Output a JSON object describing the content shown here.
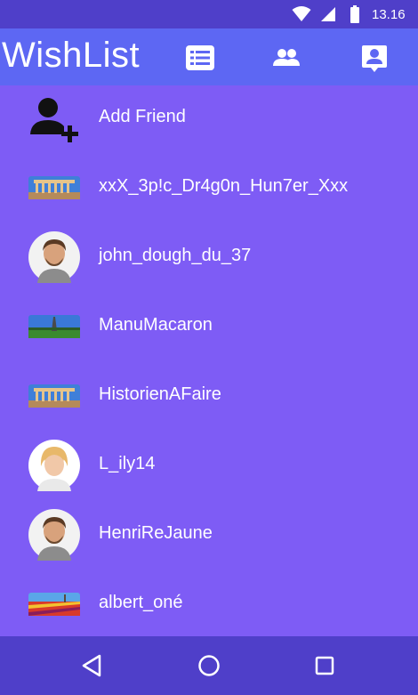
{
  "status_bar": {
    "time": "13.16",
    "icons": [
      "wifi-icon",
      "signal-icon",
      "battery-icon"
    ]
  },
  "app_bar": {
    "title": "WishList",
    "tabs": [
      {
        "icon": "list-icon"
      },
      {
        "icon": "people-icon"
      },
      {
        "icon": "account-box-icon"
      }
    ],
    "color": "#5d67f3"
  },
  "friends": {
    "add_friend_label": "Add Friend",
    "items": [
      {
        "name": "xxX_3p!c_Dr4g0n_Hun7er_Xxx",
        "avatar": "parthenon-image"
      },
      {
        "name": "john_dough_du_37",
        "avatar": "man-portrait"
      },
      {
        "name": "ManuMacaron",
        "avatar": "eiffel-tower-image"
      },
      {
        "name": "HistorienAFaire",
        "avatar": "parthenon-image"
      },
      {
        "name": "L_ily14",
        "avatar": "woman-portrait"
      },
      {
        "name": "HenriReJaune",
        "avatar": "man-portrait"
      },
      {
        "name": "albert_oné",
        "avatar": "tulip-field-image"
      }
    ]
  },
  "colors": {
    "status_bar": "#4f3fc9",
    "content_background": "#7e5cf5",
    "nav_bar": "#4f3fc9"
  },
  "nav_bar": {
    "buttons": [
      "back-icon",
      "home-icon",
      "recent-apps-icon"
    ]
  }
}
